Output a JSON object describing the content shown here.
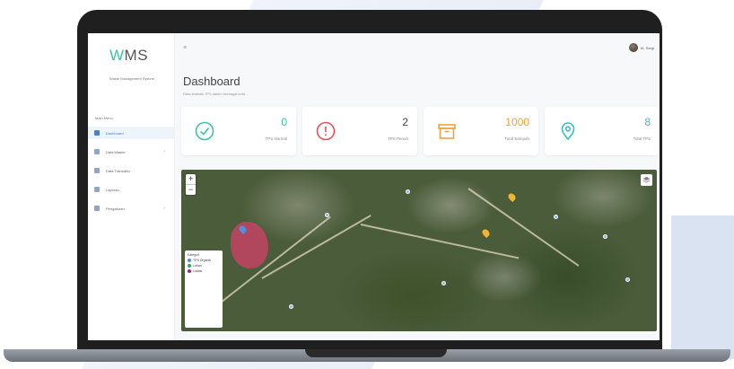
{
  "app": {
    "logo_prefix": "W",
    "logo_rest": "MS",
    "subtitle": "Waste Management System"
  },
  "sidebar": {
    "section_title": "Main Menu",
    "items": [
      {
        "label": "Dashboard",
        "icon": "home-icon",
        "active": true
      },
      {
        "label": "Data Master",
        "icon": "database-icon",
        "has_caret": true
      },
      {
        "label": "Data Transaksi",
        "icon": "transaction-icon"
      },
      {
        "label": "Laporan",
        "icon": "report-icon"
      },
      {
        "label": "Pengaturan",
        "icon": "settings-icon",
        "has_caret": true
      }
    ]
  },
  "header": {
    "menu_icon": "≡",
    "user_name": "Hi, Sergi"
  },
  "page": {
    "title": "Dashboard",
    "subtitle": "Data statistik TPS dalam berbagai kota"
  },
  "cards": [
    {
      "value": "0",
      "label": "TPS Normal",
      "color": "#3ec1a8",
      "icon": "check-circle-icon"
    },
    {
      "value": "2",
      "label": "TPS Penuh",
      "color": "#e6505a",
      "icon": "alert-circle-icon"
    },
    {
      "value": "1000",
      "label": "Total Sampah",
      "color": "#f3a23a",
      "icon": "archive-icon"
    },
    {
      "value": "8",
      "label": "Total TPS",
      "color": "#2ec4c6",
      "icon": "location-pin-icon"
    }
  ],
  "map": {
    "zoom_in": "+",
    "zoom_out": "−",
    "legend": {
      "title": "Kategori",
      "items": [
        {
          "label": "TPS Organik",
          "color": "#5b8bd6"
        },
        {
          "label": "Lahan",
          "color": "#2aa57a"
        },
        {
          "label": "Lokasi",
          "color": "#9b2a7a"
        }
      ]
    },
    "markers": [
      {
        "name": "tps-marker-orange-1",
        "color": "#f1b533"
      },
      {
        "name": "tps-marker-orange-2",
        "color": "#f1b533"
      },
      {
        "name": "tps-marker-blue",
        "color": "#4f8fe0"
      }
    ]
  }
}
